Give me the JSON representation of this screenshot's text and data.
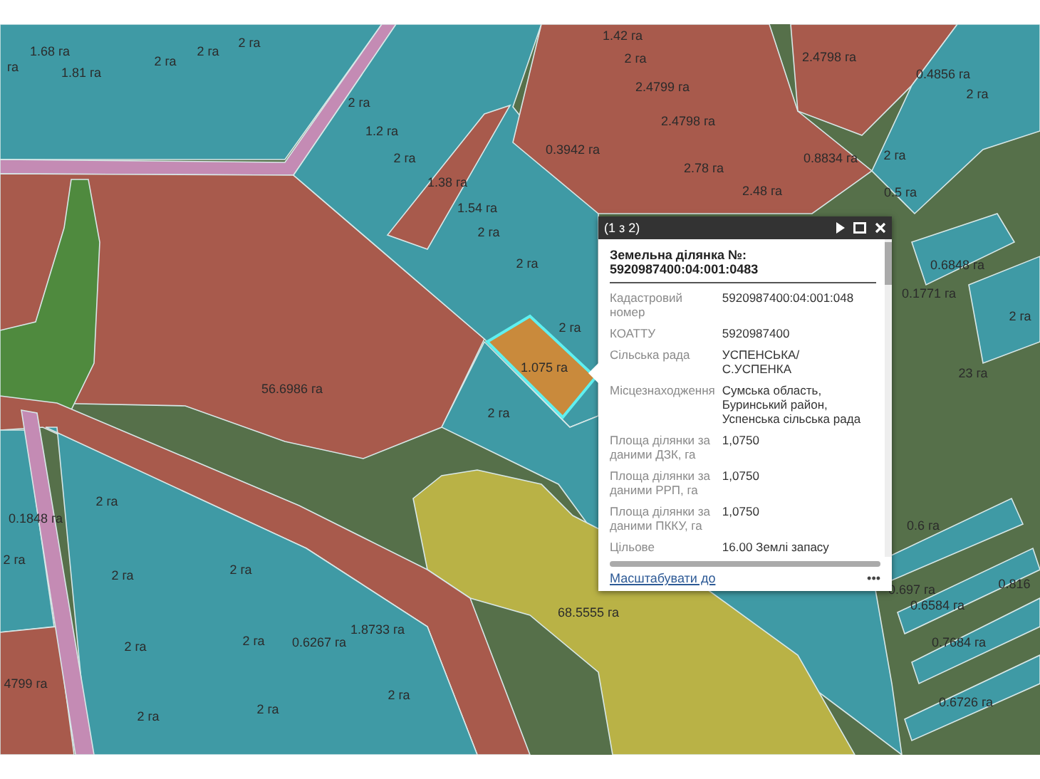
{
  "map": {
    "parcel_labels": [
      "1.68 га",
      "га",
      "1.81 га",
      "2 га",
      "2 га",
      "2 га",
      "1.42 га",
      "2 га",
      "2.4799 га",
      "2.4798 га",
      "2.4798 га",
      "0.4856 га",
      "2 га",
      "2 га",
      "1.2 га",
      "0.3942 га",
      "2 га",
      "2.78 га",
      "0.8834 га",
      "2 га",
      "1.38 га",
      "2.48 га",
      "1.54 га",
      "0.5 га",
      "2 га",
      "2 га",
      "0.6848 га",
      "0.1771 га",
      "2 га",
      "2 га",
      "1.075 га",
      "23 га",
      "56.6986 га",
      "2 га",
      "0.1848 га",
      "2 га",
      "2 га",
      "2 га",
      "2 га",
      "0.6 га",
      "68.5555 га",
      "0.697 га",
      "0.816",
      "0.6584 га",
      "2 га",
      "2 га",
      "0.6267 га",
      "1.8733 га",
      "0.7684 га",
      "4799 га",
      "2 га",
      "2 га",
      "2 га",
      "0.6726 га"
    ]
  },
  "popup": {
    "pager": "(1 з 2)",
    "title": "Земельна ділянка №: 5920987400:04:001:0483",
    "fields": [
      {
        "label": "Кадастровий номер",
        "value": "5920987400:04:001:048"
      },
      {
        "label": "КОАТТУ",
        "value": "5920987400"
      },
      {
        "label": "Сільська рада",
        "value": "УСПЕНСЬКА/\nС.УСПЕНКА"
      },
      {
        "label": "Місцезнаходження",
        "value": "Сумська область,\nБуринський район,\nУспенська сільська рада"
      },
      {
        "label": "Площа ділянки за даними ДЗК, га",
        "value": "1,0750"
      },
      {
        "label": "Площа ділянки за даними РРП, га",
        "value": "1,0750"
      },
      {
        "label": "Площа ділянки за даними ПККУ, га",
        "value": "1,0750"
      },
      {
        "label": "Цільове",
        "value": "16.00 Землі запасу"
      }
    ],
    "zoom_link": "Масштабувати до",
    "more": "•••"
  }
}
